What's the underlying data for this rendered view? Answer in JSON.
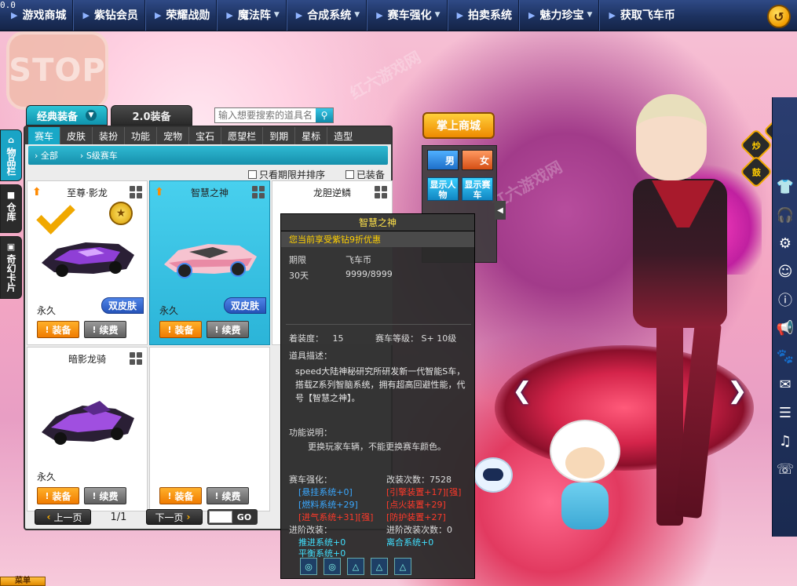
{
  "version": "0.0",
  "nav": {
    "items": [
      {
        "label": "游戏商城",
        "dropdown": false
      },
      {
        "label": "紫钻会员",
        "dropdown": false
      },
      {
        "label": "荣耀战勋",
        "dropdown": false
      },
      {
        "label": "魔法阵",
        "dropdown": true
      },
      {
        "label": "合成系统",
        "dropdown": true
      },
      {
        "label": "赛车强化",
        "dropdown": true
      },
      {
        "label": "拍卖系统",
        "dropdown": false
      },
      {
        "label": "魅力珍宝",
        "dropdown": true
      },
      {
        "label": "获取飞车币",
        "dropdown": false
      }
    ]
  },
  "stop_sign": "STOP",
  "left_tabs": [
    {
      "label": "物品栏",
      "active": true
    },
    {
      "label": "仓库",
      "active": false
    },
    {
      "label": "奇幻卡片",
      "active": false
    }
  ],
  "panel_tabs": {
    "classic": "经典装备",
    "v2": "2.0装备"
  },
  "search": {
    "placeholder": "输入想要搜索的道具名"
  },
  "categories": [
    "赛车",
    "皮肤",
    "装扮",
    "功能",
    "宠物",
    "宝石",
    "愿望栏",
    "到期",
    "星标",
    "造型"
  ],
  "breadcrumb": {
    "all": "全部",
    "sub": "S级赛车"
  },
  "filters": {
    "expiry_sort": "只看期限并排序",
    "equipped": "已装备"
  },
  "items": [
    {
      "name": "至尊·影龙",
      "duration": "永久",
      "skin": "双皮肤",
      "equipped": true
    },
    {
      "name": "智慧之神",
      "duration": "永久",
      "skin": "双皮肤",
      "selected": true
    },
    {
      "name": "龙胆逆鳞",
      "duration": "",
      "skin": ""
    },
    {
      "name": "暗影龙骑",
      "duration": "永久",
      "skin": ""
    }
  ],
  "buttons": {
    "equip": "装备",
    "renew": "续费"
  },
  "pager": {
    "prev": "上一页",
    "next": "下一页",
    "page": "1/1",
    "go": "GO"
  },
  "tooltip": {
    "title": "智慧之神",
    "promo": "您当前享受紫钻9折优惠",
    "col_period": "期限",
    "col_price": "飞车币",
    "period_value": "30天",
    "price_value": "9999/8999",
    "wear_label": "着装度：",
    "wear_value": "15",
    "grade_label": "赛车等级：",
    "grade_value": "S+ 10级",
    "desc_label": "道具描述：",
    "desc": "speed大陆神秘研究所研发新一代智能S车，搭载Z系列智脑系统，拥有超高回避性能，代号【智慧之神】。",
    "func_label": "功能说明：",
    "func": "更换玩家车辆，不能更换赛车颜色。",
    "enhance_label": "赛车强化：",
    "mod_count_label": "改装次数：",
    "mod_count": "7528",
    "enh": [
      {
        "text": "[悬挂系统+0]",
        "color": "blue"
      },
      {
        "text": "[引擎装置+17][强]",
        "color": "red"
      },
      {
        "text": "[燃料系统+29]",
        "color": "blue"
      },
      {
        "text": "[点火装置+29]",
        "color": "red"
      },
      {
        "text": "[进气系统+31][强]",
        "color": "red"
      },
      {
        "text": "[防护装置+27]",
        "color": "red"
      }
    ],
    "adv_label": "进阶改装：",
    "adv_count_label": "进阶改装次数：",
    "adv_count": "0",
    "adv": [
      "推进系统+0",
      "离合系统+0",
      "平衡系统+0"
    ]
  },
  "mini": {
    "shop": "掌上商城",
    "male": "男",
    "female": "女",
    "show_person": "显示人物",
    "show_car": "显示赛车"
  },
  "bottom_tab": "菜单",
  "colors": {
    "accent": "#1aa4c6",
    "nav_bg": "#1d3260",
    "equip": "#f07b00"
  }
}
